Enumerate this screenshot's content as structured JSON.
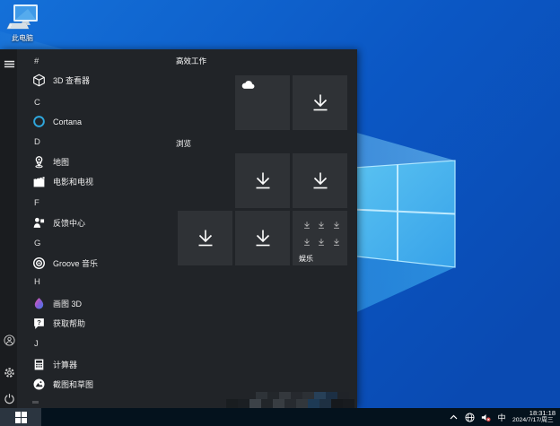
{
  "desktop": {
    "icons": [
      {
        "label": "此电脑"
      }
    ]
  },
  "start_menu": {
    "app_list": [
      {
        "kind": "group",
        "label": "#"
      },
      {
        "kind": "app",
        "label": "3D 查看器",
        "icon": "cube-icon"
      },
      {
        "kind": "group",
        "label": "C"
      },
      {
        "kind": "app",
        "label": "Cortana",
        "icon": "cortana-icon"
      },
      {
        "kind": "group",
        "label": "D"
      },
      {
        "kind": "app",
        "label": "地图",
        "icon": "map-pin-icon"
      },
      {
        "kind": "app",
        "label": "电影和电视",
        "icon": "movies-tv-icon"
      },
      {
        "kind": "group",
        "label": "F"
      },
      {
        "kind": "app",
        "label": "反馈中心",
        "icon": "feedback-hub-icon"
      },
      {
        "kind": "group",
        "label": "G"
      },
      {
        "kind": "app",
        "label": "Groove 音乐",
        "icon": "groove-music-icon"
      },
      {
        "kind": "group",
        "label": "H"
      },
      {
        "kind": "app",
        "label": "画图 3D",
        "icon": "paint-3d-icon"
      },
      {
        "kind": "app",
        "label": "获取帮助",
        "icon": "get-help-icon"
      },
      {
        "kind": "group",
        "label": "J"
      },
      {
        "kind": "app",
        "label": "计算器",
        "icon": "calculator-icon"
      },
      {
        "kind": "app",
        "label": "截图和草图",
        "icon": "snip-sketch-icon"
      }
    ],
    "tile_groups": {
      "g1_title": "高效工作",
      "g2_title": "浏览"
    },
    "folder_tile": {
      "label": "娱乐"
    }
  },
  "taskbar": {
    "tray": {
      "ime_label": "中",
      "time": "18:31:18",
      "date": "2024/7/17/周三"
    }
  },
  "colors": {
    "accent_blue": "#0a52bd",
    "menu_bg": "#212428",
    "tile_bg": "#2f3236",
    "taskbar_bg": "#04121d",
    "cortana_ring": "#2fa7dd"
  }
}
